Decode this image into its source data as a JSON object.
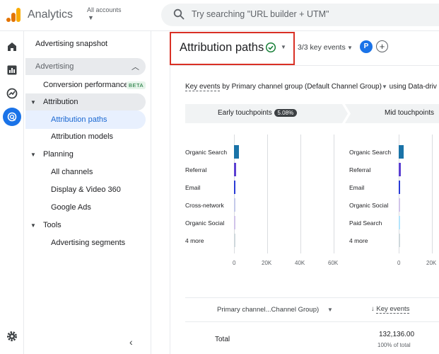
{
  "app": {
    "title": "Analytics",
    "account_label": "All accounts",
    "search_placeholder": "Try searching \"URL builder + UTM\""
  },
  "sidebar": {
    "snapshot": "Advertising snapshot",
    "group": "Advertising",
    "conversion_performance": "Conversion performance",
    "beta": "BETA",
    "attribution": "Attribution",
    "attribution_paths": "Attribution paths",
    "attribution_models": "Attribution models",
    "planning": "Planning",
    "all_channels": "All channels",
    "display_video": "Display & Video 360",
    "google_ads": "Google Ads",
    "tools": "Tools",
    "advertising_segments": "Advertising segments"
  },
  "header": {
    "title": "Attribution paths",
    "key_events": "3/3 key events",
    "avatar_letter": "P"
  },
  "filter": {
    "key_events": "Key events",
    "by": "by",
    "dimension": "Primary channel group (Default Channel Group)",
    "using": "using Data-driv"
  },
  "stages": {
    "early": "Early touchpoints",
    "early_pct": "5.08%",
    "mid": "Mid touchpoints"
  },
  "chart_data": [
    {
      "type": "bar",
      "title": "Early touchpoints",
      "categories": [
        "Organic Search",
        "Referral",
        "Email",
        "Cross-network",
        "Organic Social",
        "4 more"
      ],
      "values": [
        3000,
        1400,
        900,
        300,
        250,
        200
      ],
      "xticks": [
        "0",
        "20K",
        "40K",
        "60K"
      ],
      "xlim": [
        0,
        60000
      ],
      "colors": [
        "#1a73a8",
        "#5b3fd1",
        "#2a3bd6",
        "#c5cae9",
        "#d1c4e9",
        "#cfd8dc"
      ]
    },
    {
      "type": "bar",
      "title": "Mid touchpoints",
      "categories": [
        "Organic Search",
        "Referral",
        "Email",
        "Organic Social",
        "Paid Search",
        "4 more"
      ],
      "values": [
        3000,
        1400,
        900,
        300,
        250,
        200
      ],
      "xticks": [
        "0",
        "20K"
      ],
      "xlim": [
        0,
        60000
      ],
      "colors": [
        "#1a73a8",
        "#5b3fd1",
        "#2a3bd6",
        "#d1c4e9",
        "#b3e5fc",
        "#cfd8dc"
      ]
    }
  ],
  "table": {
    "dimension_header": "Primary channel...Channel Group)",
    "metric_header": "Key events",
    "total_label": "Total",
    "total_value": "132,136.00",
    "total_sub": "100% of total"
  }
}
